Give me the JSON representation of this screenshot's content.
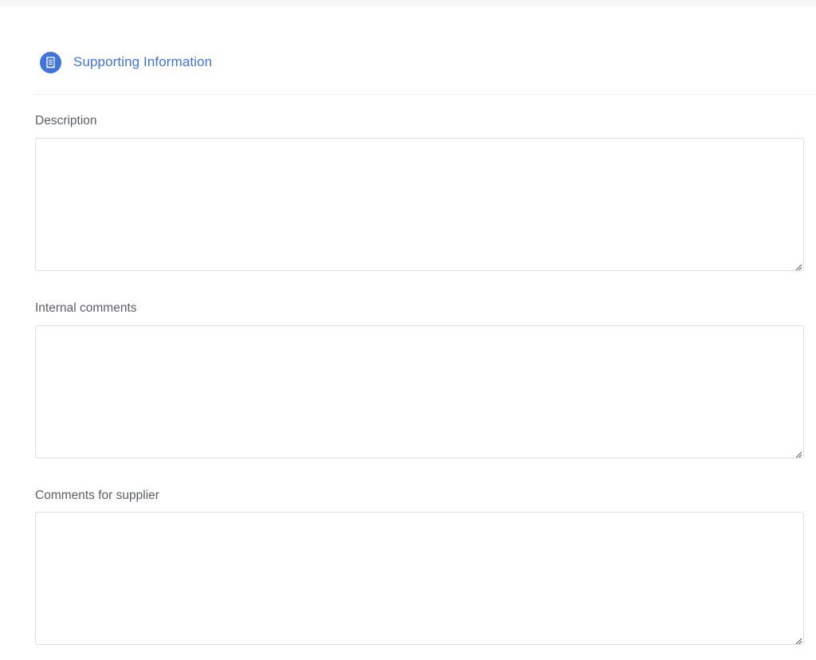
{
  "section": {
    "title": "Supporting Information",
    "icon": "receipt-icon",
    "accent_color": "#3f74de"
  },
  "fields": [
    {
      "label": "Description",
      "value": ""
    },
    {
      "label": "Internal comments",
      "value": ""
    },
    {
      "label": "Comments for supplier",
      "value": ""
    }
  ]
}
